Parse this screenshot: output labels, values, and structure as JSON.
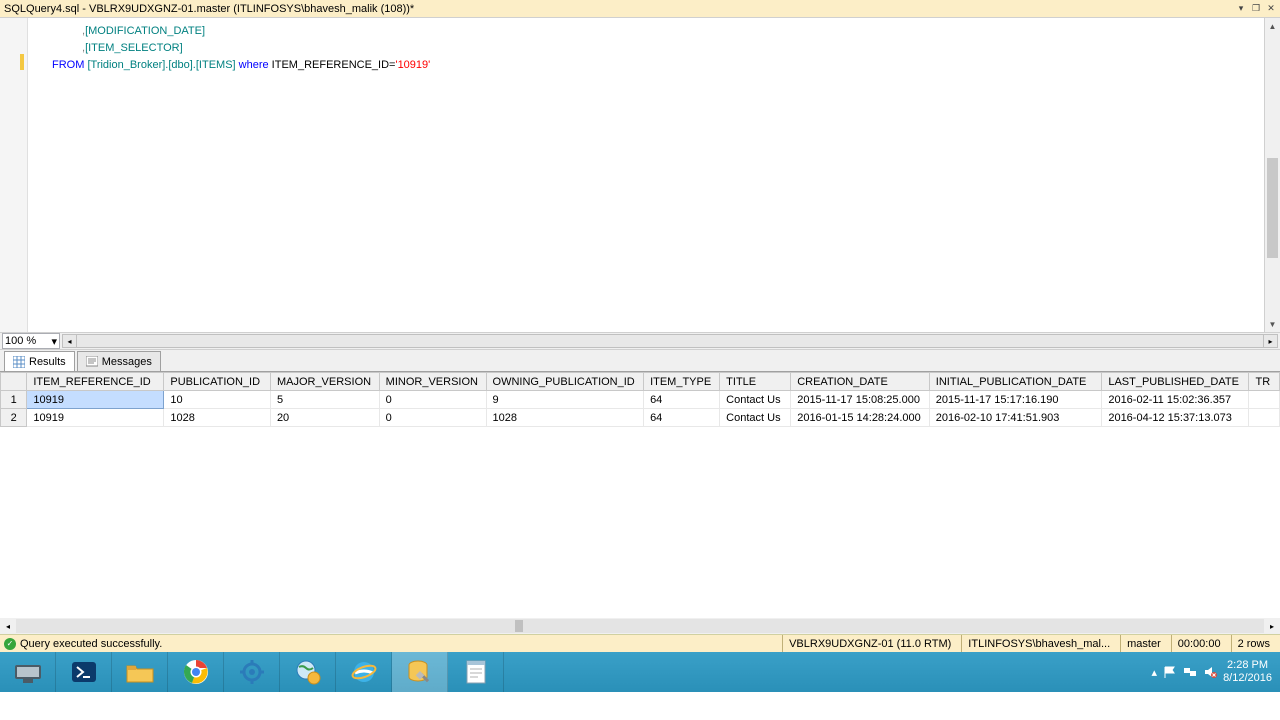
{
  "title": "SQLQuery4.sql - VBLRX9UDXGNZ-01.master (ITLINFOSYS\\bhavesh_malik (108))*",
  "sql": {
    "line1_punct": ",",
    "line1_col": "[MODIFICATION_DATE]",
    "line2_punct": ",",
    "line2_col": "[ITEM_SELECTOR]",
    "from_kw": "FROM",
    "from_obj": " [Tridion_Broker].[dbo].[ITEMS] ",
    "where_kw": "where",
    "where_col": " ITEM_REFERENCE_ID=",
    "where_val": "'10919'"
  },
  "zoom": "100 %",
  "tabs": {
    "results": "Results",
    "messages": "Messages"
  },
  "columns": [
    "ITEM_REFERENCE_ID",
    "PUBLICATION_ID",
    "MAJOR_VERSION",
    "MINOR_VERSION",
    "OWNING_PUBLICATION_ID",
    "ITEM_TYPE",
    "TITLE",
    "CREATION_DATE",
    "INITIAL_PUBLICATION_DATE",
    "LAST_PUBLISHED_DATE",
    "TR"
  ],
  "rows": [
    {
      "n": "1",
      "c": [
        "10919",
        "10",
        "5",
        "0",
        "9",
        "64",
        "Contact Us",
        "2015-11-17 15:08:25.000",
        "2015-11-17 15:17:16.190",
        "2016-02-11 15:02:36.357",
        ""
      ]
    },
    {
      "n": "2",
      "c": [
        "10919",
        "1028",
        "20",
        "0",
        "1028",
        "64",
        "Contact Us",
        "2016-01-15 14:28:24.000",
        "2016-02-10 17:41:51.903",
        "2016-04-12 15:37:13.073",
        ""
      ]
    }
  ],
  "status": {
    "msg": "Query executed successfully.",
    "server": "VBLRX9UDXGNZ-01 (11.0 RTM)",
    "user": "ITLINFOSYS\\bhavesh_mal...",
    "db": "master",
    "time": "00:00:00",
    "rows": "2 rows"
  },
  "clock": {
    "time": "2:28 PM",
    "date": "8/12/2016"
  }
}
